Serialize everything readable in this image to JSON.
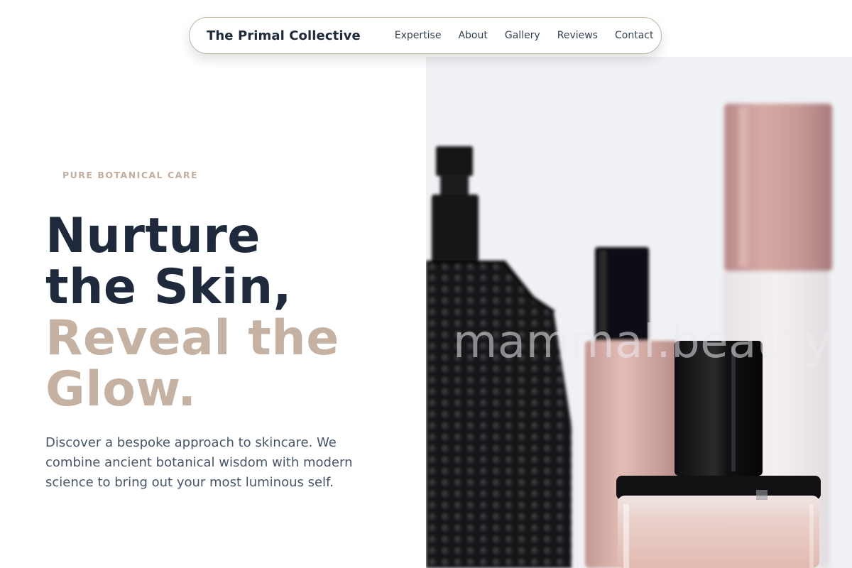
{
  "nav": {
    "brand": "The Primal Collective",
    "links": [
      "Expertise",
      "About",
      "Gallery",
      "Reviews",
      "Contact"
    ]
  },
  "hero": {
    "eyebrow": "PURE BOTANICAL CARE",
    "headline_line1": "Nurture",
    "headline_line2": "the Skin,",
    "headline_line3": "Reveal the",
    "headline_line4": "Glow.",
    "lead": "Discover a bespoke approach to skincare. We combine ancient botanical wisdom with modern science to bring out your most luminous self."
  },
  "image": {
    "watermark": "mammal.beauty",
    "subject": "perfume-bottles-photo"
  },
  "colors": {
    "brand_dark": "#1e293b",
    "accent_beige": "#c5b2a3",
    "body_text": "#475569"
  }
}
